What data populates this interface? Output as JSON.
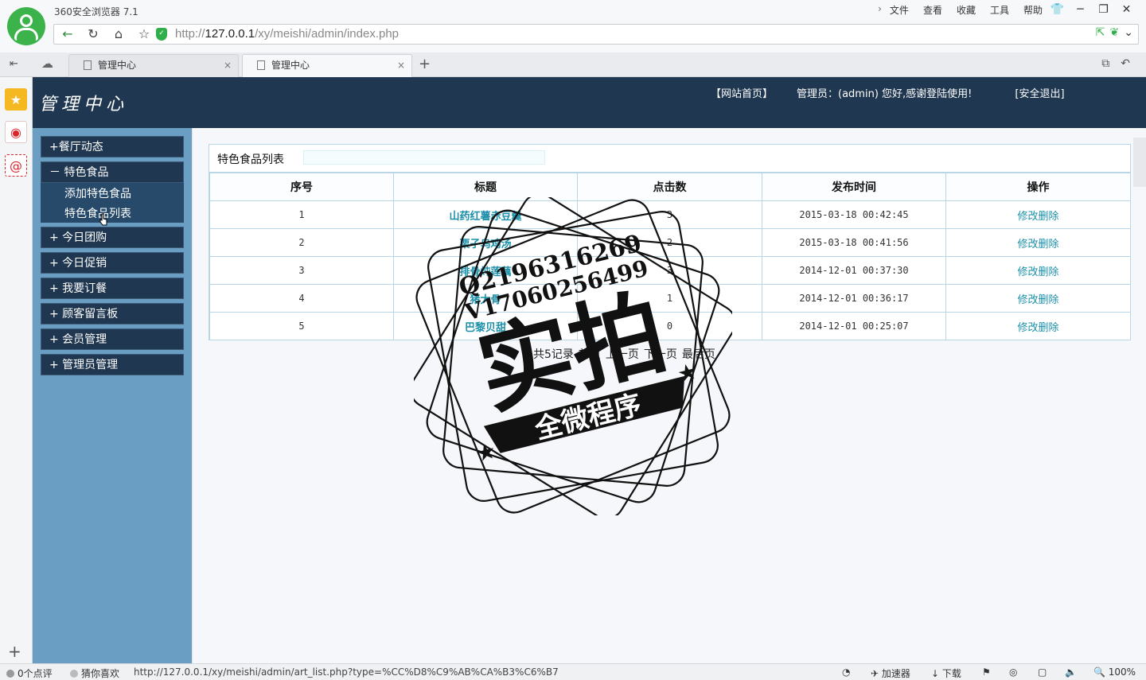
{
  "browser": {
    "app_title": "360安全浏览器 7.1",
    "menu": [
      "文件",
      "查看",
      "收藏",
      "工具",
      "帮助"
    ],
    "url_prefix": "http://",
    "url_host": "127.0.0.1",
    "url_path": "/xy/meishi/admin/index.php",
    "tabs": [
      {
        "label": "管理中心",
        "active": false
      },
      {
        "label": "管理中心",
        "active": true
      }
    ],
    "status_url": "http://127.0.0.1/xy/meishi/admin/art_list.php?type=%CC%D8%C9%AB%CA%B3%C6%B7",
    "status_left1": "0个点评",
    "status_left2": "猜你喜欢",
    "status_accel": "加速器",
    "status_download": "下载",
    "zoom": "100%"
  },
  "header": {
    "brand": "管理中心",
    "home_link": "【网站首页】",
    "admin_text": "管理员：(admin) 您好,感谢登陆使用!",
    "logout": "[安全退出]"
  },
  "nav": {
    "groups": [
      "+餐厅动态",
      "－ 特色食品",
      "+ 今日团购",
      "+ 今日促销",
      "+ 我要订餐",
      "+ 顾客留言板",
      "+ 会员管理",
      "+ 管理员管理"
    ],
    "subitems": [
      "添加特色食品",
      "特色食品列表"
    ]
  },
  "list": {
    "title": "特色食品列表",
    "columns": [
      "序号",
      "标题",
      "点击数",
      "发布时间",
      "操作"
    ],
    "rows": [
      {
        "id": "1",
        "title": "山药红薯赤豆羹",
        "clicks": "3",
        "time": "2015-03-18 00:42:45"
      },
      {
        "id": "2",
        "title": "栗子乌鸡汤",
        "clicks": "2",
        "time": "2015-03-18 00:41:56"
      },
      {
        "id": "3",
        "title": "排骨炖莲藕",
        "clicks": "3",
        "time": "2014-12-01 00:37:30"
      },
      {
        "id": "4",
        "title": "猪大骨",
        "clicks": "1",
        "time": "2014-12-01 00:36:17"
      },
      {
        "id": "5",
        "title": "巴黎贝甜",
        "clicks": "0",
        "time": "2014-12-01 00:25:07"
      }
    ],
    "edit_label": "修改",
    "delete_label": "删除"
  },
  "pager": {
    "total": "共5记录",
    "first": "首页",
    "prev": "上一页",
    "next": "下一页",
    "last": "最后页"
  },
  "watermark": {
    "line1": "Q2196316269",
    "line2": "V17060256499",
    "main": "实拍",
    "ribbon": "全微程序"
  }
}
